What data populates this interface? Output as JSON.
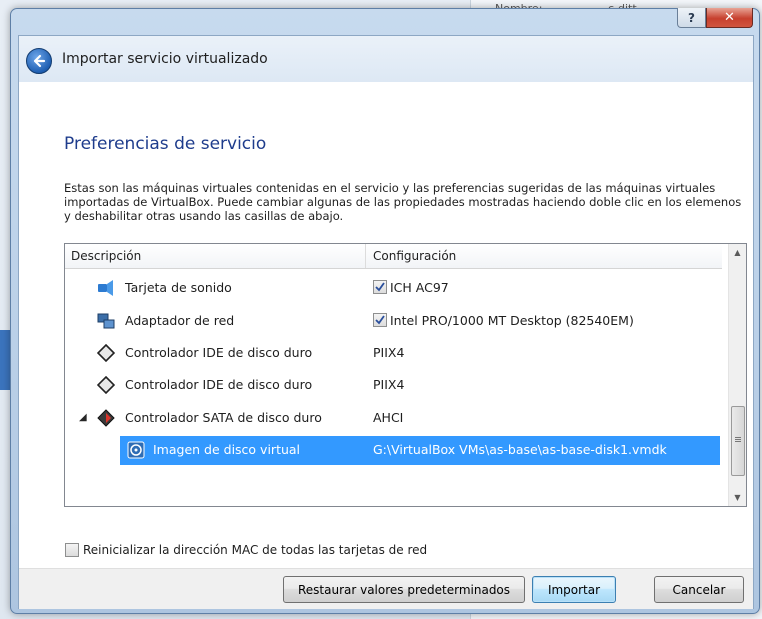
{
  "background": {
    "text1": "Nombre:",
    "text2": "c-ditt"
  },
  "window": {
    "help_label": "?",
    "close_label": "✕"
  },
  "wizard": {
    "title": "Importar servicio virtualizado",
    "section_title": "Preferencias de servicio",
    "description": "Estas son las máquinas virtuales contenidas en el servicio y las preferencias sugeridas de las máquinas virtuales importadas de VirtualBox. Puede cambiar algunas de las propiedades mostradas haciendo doble clic en los elemenos y deshabilitar otras usando las casillas de abajo."
  },
  "table": {
    "columns": [
      "Descripción",
      "Configuración"
    ],
    "rows": [
      {
        "label": "Tarjeta de sonido",
        "value": "ICH AC97",
        "checked": true,
        "icon": "sound-card-icon"
      },
      {
        "label": "Adaptador de red",
        "value": "Intel PRO/1000 MT Desktop (82540EM)",
        "checked": true,
        "icon": "network-adapter-icon"
      },
      {
        "label": "Controlador IDE de disco duro",
        "value": "PIIX4",
        "icon": "ide-controller-icon"
      },
      {
        "label": "Controlador IDE de disco duro",
        "value": "PIIX4",
        "icon": "ide-controller-icon"
      },
      {
        "label": "Controlador SATA de disco duro",
        "value": "AHCI",
        "icon": "sata-controller-icon",
        "expanded": true
      },
      {
        "label": "Imagen de disco virtual",
        "value": "G:\\VirtualBox VMs\\as-base\\as-base-disk1.vmdk",
        "icon": "disk-image-icon",
        "selected": true
      }
    ],
    "expander_glyph": "◢"
  },
  "options": {
    "mac_reset_label": "Reinicializar la dirección MAC de todas las tarjetas de red",
    "mac_reset_checked": false
  },
  "buttons": {
    "restore": "Restaurar valores predeterminados",
    "import": "Importar",
    "cancel": "Cancelar"
  },
  "colors": {
    "selection": "#3399ff",
    "section_title": "#1e3c8c"
  }
}
